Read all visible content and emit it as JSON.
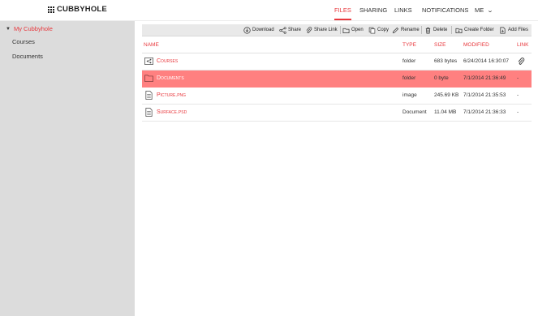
{
  "app": {
    "title": "CUBBYHOLE"
  },
  "nav": {
    "files": "FILES",
    "sharing": "SHARING",
    "links": "LINKS",
    "notifications": "NOTIFICATIONS",
    "me": "ME"
  },
  "sidebar": {
    "root": "My Cubbyhole",
    "items": [
      "Courses",
      "Documents"
    ]
  },
  "toolbar": {
    "download": "Download",
    "share": "Share",
    "share_link": "Share Link",
    "open": "Open",
    "copy": "Copy",
    "rename": "Rename",
    "delete": "Delete",
    "create_folder": "Create Folder",
    "add_files": "Add Files"
  },
  "table": {
    "headers": {
      "name": "Name",
      "type": "Type",
      "size": "Size",
      "modified": "Modified",
      "link": "Link"
    },
    "rows": [
      {
        "name": "Courses",
        "type": "folder",
        "size": "683 bytes",
        "modified": "6/24/2014 16:30:07",
        "link": "",
        "icon": "shared-folder-icon"
      },
      {
        "name": "Documents",
        "type": "folder",
        "size": "0 byte",
        "modified": "7/1/2014 21:36:49",
        "link": "-",
        "icon": "folder-icon"
      },
      {
        "name": "Picture.png",
        "type": "image",
        "size": "245.69 KB",
        "modified": "7/1/2014 21:35:53",
        "link": "-",
        "icon": "file-icon"
      },
      {
        "name": "Surface.psd",
        "type": "Document",
        "size": "11.04 MB",
        "modified": "7/1/2014 21:36:33",
        "link": "-",
        "icon": "file-icon"
      }
    ]
  },
  "colors": {
    "accent": "#e8383d",
    "selected_row": "#ff8080",
    "sidebar_bg": "#dcdcdc",
    "toolbar_bg": "#e9e9e9"
  }
}
